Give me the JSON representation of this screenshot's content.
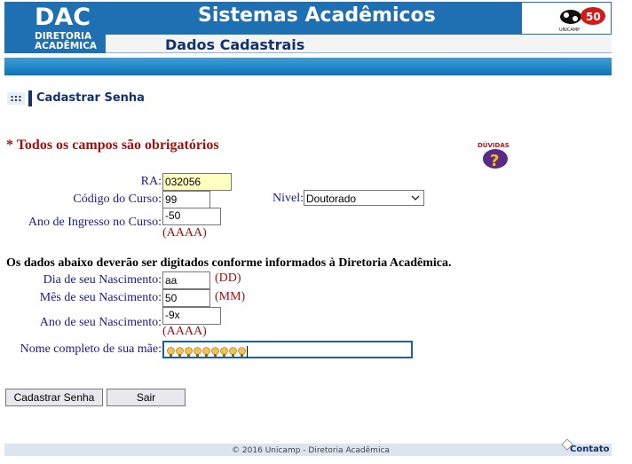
{
  "header": {
    "logo_main": "DAC",
    "logo_line1": "DIRETORIA",
    "logo_line2": "ACADÊMICA",
    "title": "Sistemas Acadêmicos",
    "subtitle": "Dados Cadastrais",
    "unicamp_text": "UNICAMP"
  },
  "breadcrumb": {
    "dots": ":::",
    "label": "Cadastrar Senha"
  },
  "required_notice": "* Todos os campos são obrigatórios",
  "help_badge": "DÚVIDAS",
  "form": {
    "ra_label": "RA:",
    "ra_value": "032056",
    "course_label": "Código do Curso:",
    "course_value": "99",
    "level_label": "Nivel:",
    "level_value": "Doutorado",
    "year_label": "Ano de Ingresso no Curso:",
    "year_value": "-50",
    "year_hint": "(AAAA)",
    "instructions": "Os dados abaixo deverão ser digitados conforme informados à Diretoria Acadêmica.",
    "day_label": "Dia de seu Nascimento:",
    "day_value": "aa",
    "day_hint": "(DD)",
    "month_label": "Mês de seu Nascimento:",
    "month_value": "50",
    "month_hint": "(MM)",
    "birth_year_label": "Ano de seu Nascimento:",
    "birth_year_value": "-9x",
    "birth_year_hint": "(AAAA)",
    "mother_label": "Nome completo de sua mãe:",
    "mother_glyph_count": 9
  },
  "buttons": {
    "submit": "Cadastrar Senha",
    "exit": "Sair"
  },
  "footer": {
    "copyright": "© 2016 Unicamp - Diretoria Acadêmica",
    "contact": "Contato"
  },
  "colors": {
    "brand_blue": "#1f6fb3",
    "dark_navy": "#13316b",
    "required_red": "#a01010",
    "ra_highlight": "#ffffc0"
  }
}
